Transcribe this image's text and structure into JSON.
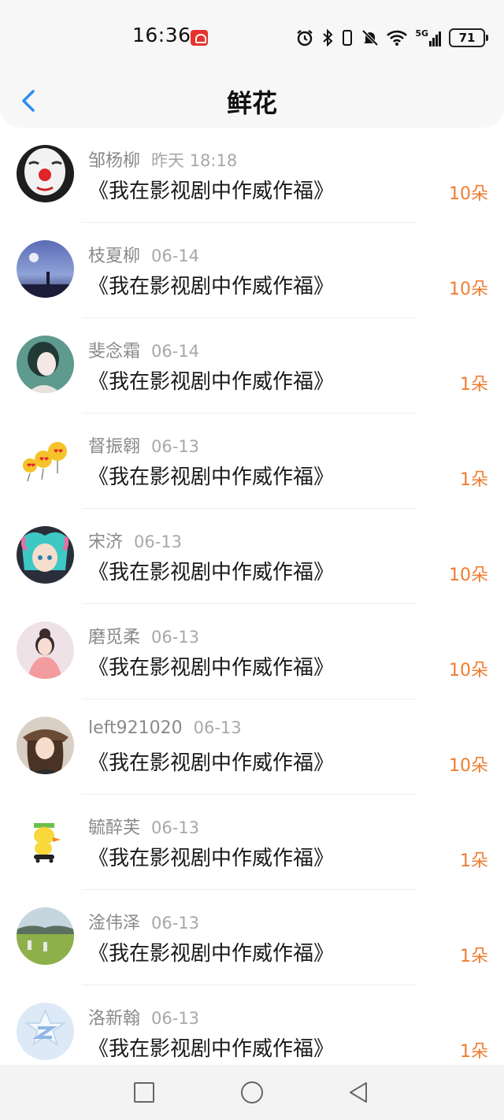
{
  "status": {
    "time": "16:36",
    "network": "5G",
    "battery": "71"
  },
  "header": {
    "title": "鲜花"
  },
  "rows": [
    {
      "name": "邹杨柳",
      "time": "昨天 18:18",
      "title": "《我在影视剧中作威作福》",
      "count": "10朵"
    },
    {
      "name": "枝夏柳",
      "time": "06-14",
      "title": "《我在影视剧中作威作福》",
      "count": "10朵"
    },
    {
      "name": "斐念霜",
      "time": "06-14",
      "title": "《我在影视剧中作威作福》",
      "count": "1朵"
    },
    {
      "name": "督振翱",
      "time": "06-13",
      "title": "《我在影视剧中作威作福》",
      "count": "1朵"
    },
    {
      "name": "宋济",
      "time": "06-13",
      "title": "《我在影视剧中作威作福》",
      "count": "10朵"
    },
    {
      "name": "磨觅柔",
      "time": "06-13",
      "title": "《我在影视剧中作威作福》",
      "count": "10朵"
    },
    {
      "name": "left921020",
      "time": "06-13",
      "title": "《我在影视剧中作威作福》",
      "count": "10朵"
    },
    {
      "name": "毓醉芙",
      "time": "06-13",
      "title": "《我在影视剧中作威作福》",
      "count": "1朵"
    },
    {
      "name": "淦伟泽",
      "time": "06-13",
      "title": "《我在影视剧中作威作福》",
      "count": "1朵"
    },
    {
      "name": "洛新翰",
      "time": "06-13",
      "title": "《我在影视剧中作威作福》",
      "count": "1朵"
    }
  ],
  "colors": {
    "accent": "#2d8cf0",
    "count": "#f07c30"
  }
}
